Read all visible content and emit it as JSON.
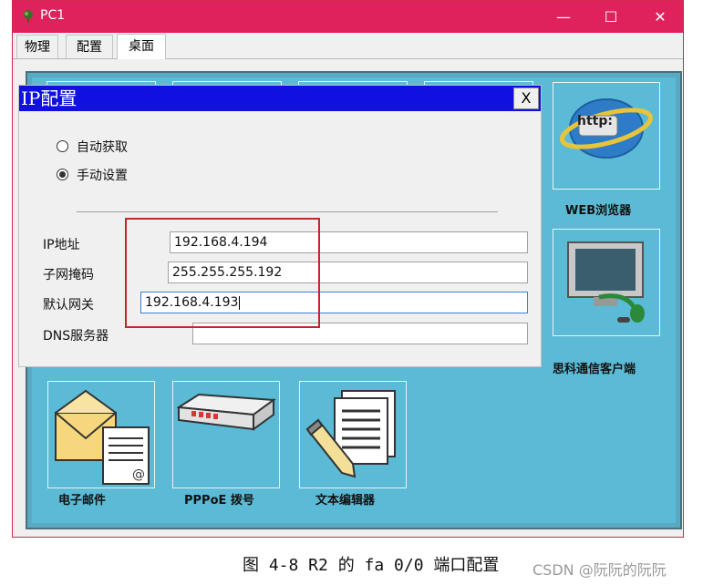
{
  "window": {
    "title": "PC1",
    "minimize": "—",
    "maximize": "☐",
    "close": "✕"
  },
  "tabs": [
    {
      "label": "物理"
    },
    {
      "label": "配置"
    },
    {
      "label": "桌面",
      "active": true
    }
  ],
  "desktop": {
    "web_browser": {
      "label": "WEB浏览器",
      "icon_text": "http:"
    },
    "cisco_client": {
      "label": "思科通信客户端"
    },
    "email": {
      "label": "电子邮件"
    },
    "pppoe": {
      "label": "PPPoE 拨号"
    },
    "text_editor": {
      "label": "文本编辑器"
    }
  },
  "ip_dialog": {
    "title": "IP配置",
    "close_label": "X",
    "mode_dhcp": "自动获取",
    "mode_static": "手动设置",
    "selected_mode": "手动设置",
    "ip_label": "IP地址",
    "ip_value": "192.168.4.194",
    "mask_label": "子网掩码",
    "mask_value": "255.255.255.192",
    "gateway_label": "默认网关",
    "gateway_value": "192.168.4.193",
    "dns_label": "DNS服务器",
    "dns_value": ""
  },
  "caption": "图 4-8 R2 的 fa 0/0 端口配置",
  "watermark": "CSDN @阮阮的阮阮",
  "colors": {
    "titlebar": "#e0225c",
    "desktop": "#5bbad5",
    "dialog_title": "#1010e0",
    "highlight_box": "#c0282c"
  }
}
